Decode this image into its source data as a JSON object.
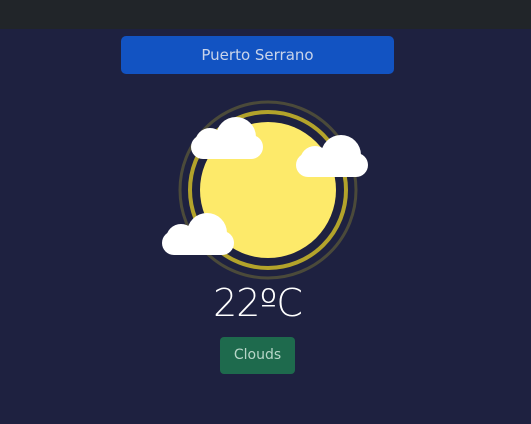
{
  "location": {
    "city": "Puerto Serrano"
  },
  "weather": {
    "temperature": "22ºC",
    "condition": "Clouds",
    "icon": "sun-with-clouds-icon"
  },
  "colors": {
    "background": "#1e2140",
    "topbar": "#212529",
    "city_button": "#1253c2",
    "condition_badge": "#1e6a4d",
    "sun": "#fdea6a",
    "sun_ring": "#b3a32b"
  }
}
